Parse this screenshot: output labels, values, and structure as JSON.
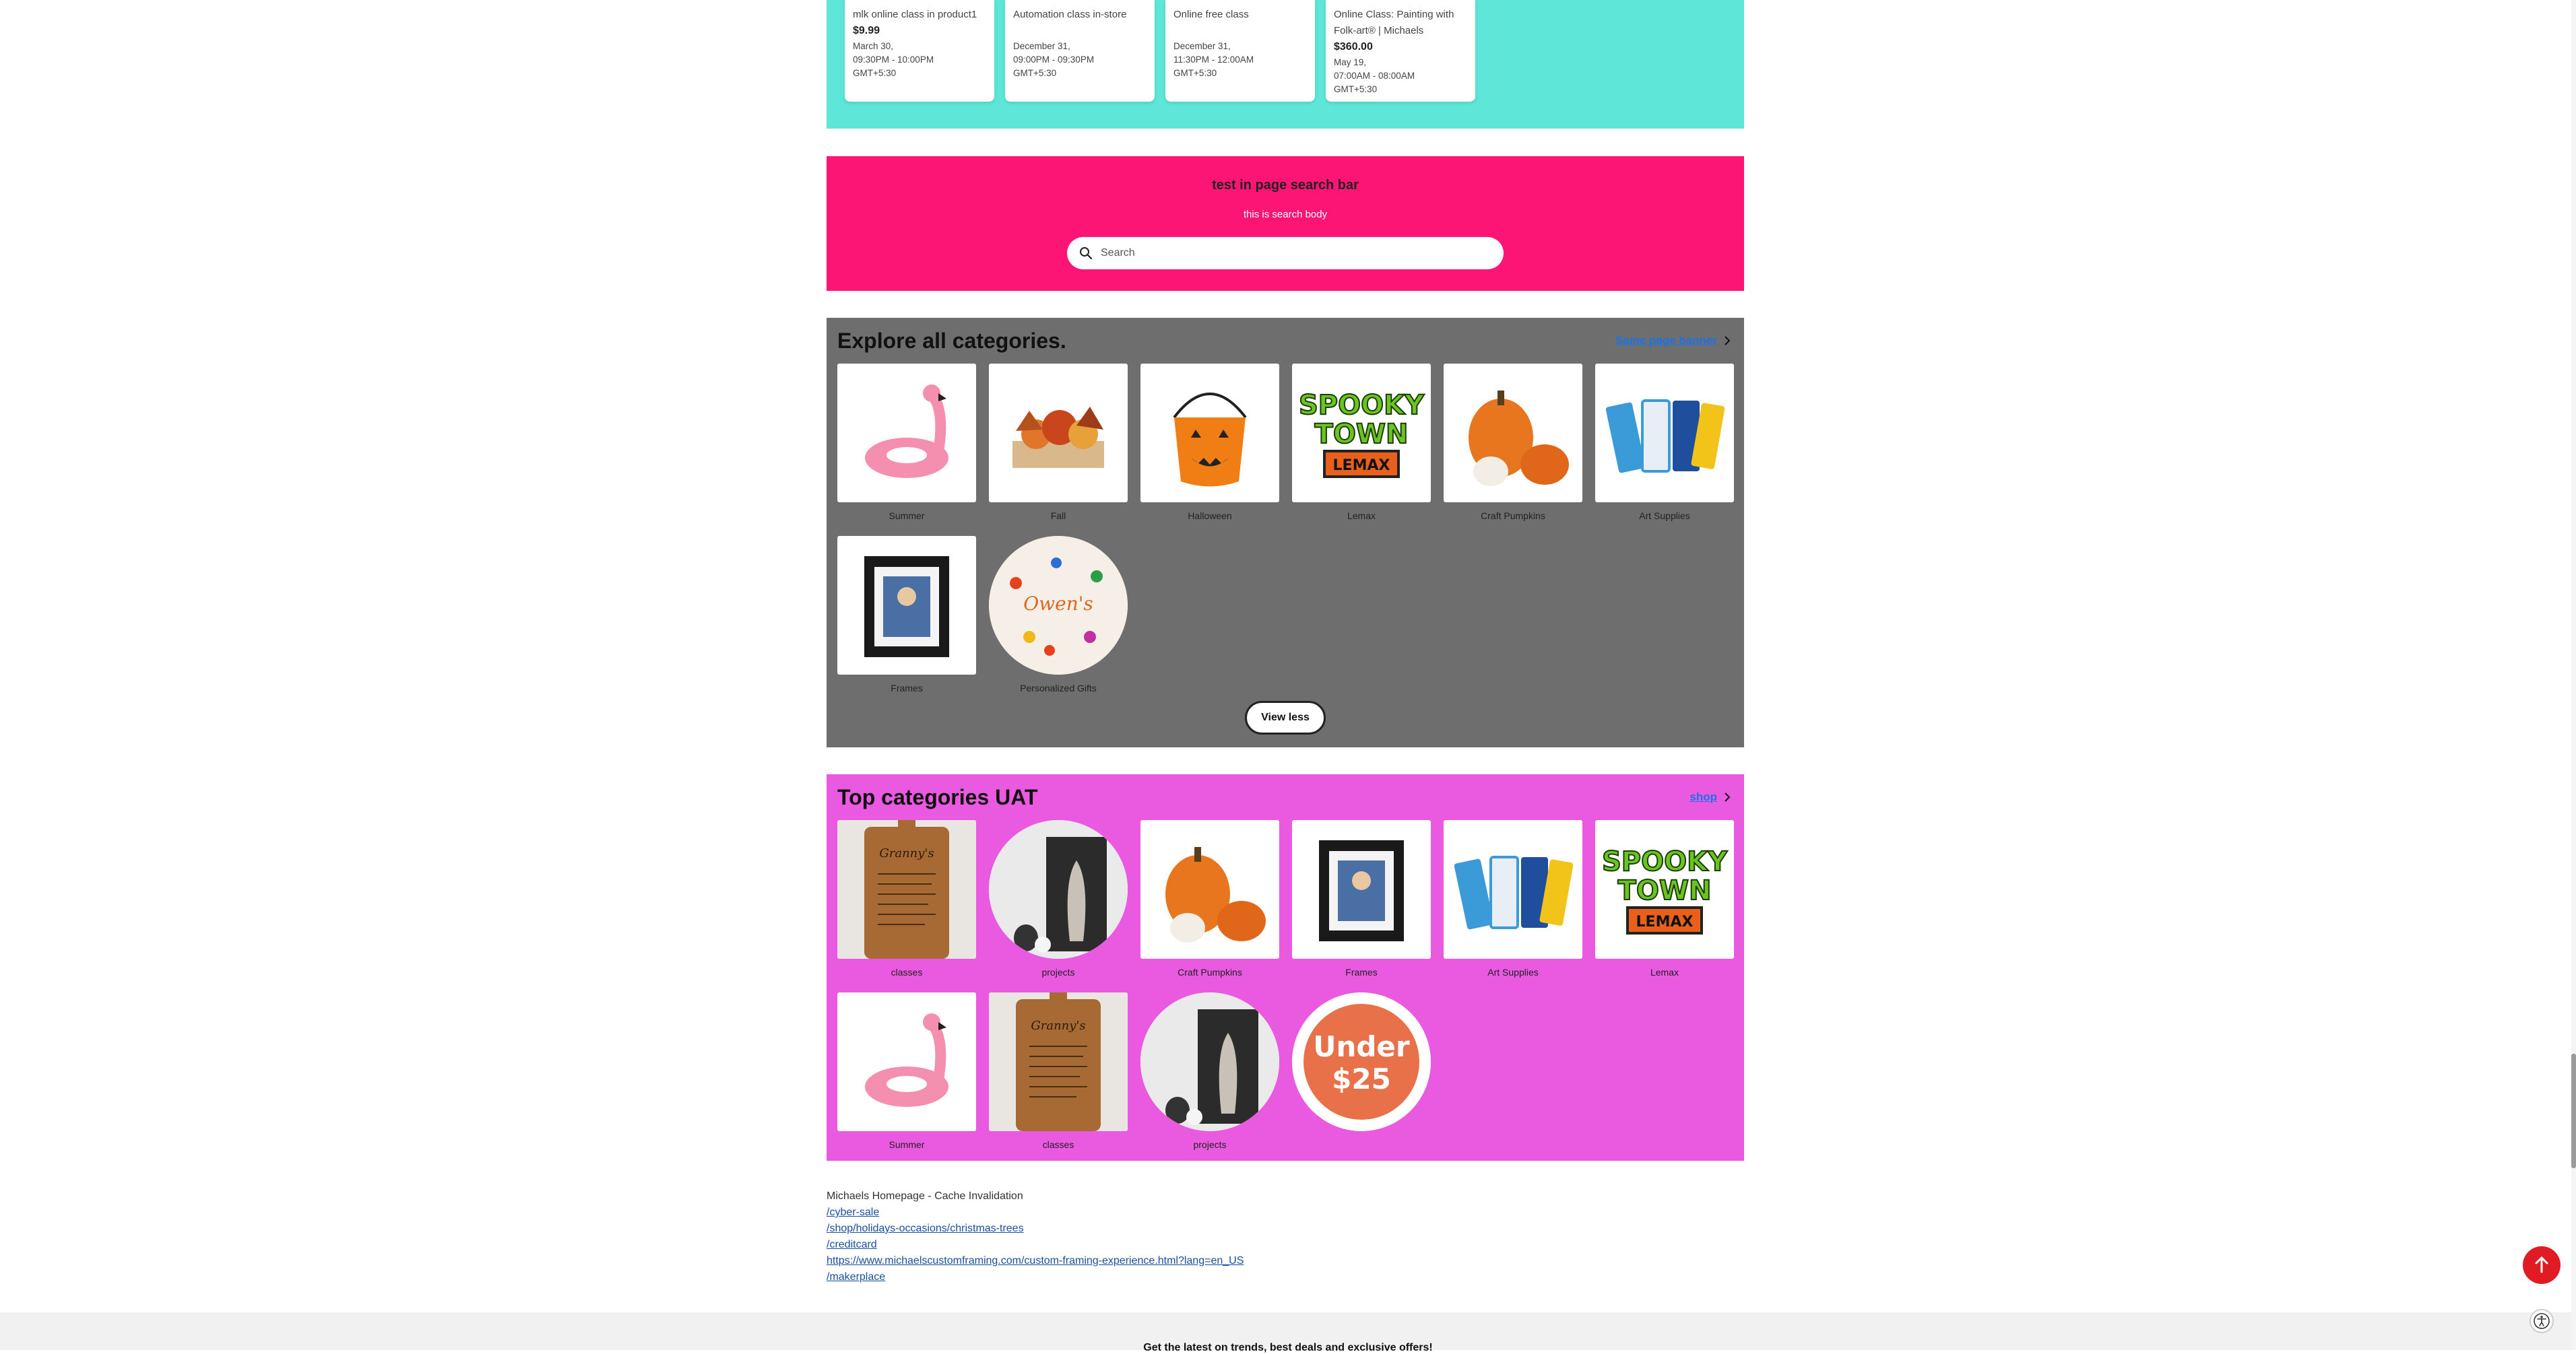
{
  "classes": [
    {
      "title": "mlk online class in product1",
      "price": "$9.99",
      "date": "March 30,",
      "time": "09:30PM - 10:00PM",
      "tz": "GMT+5:30"
    },
    {
      "title": "Automation class in-store",
      "price": "",
      "date": "December 31,",
      "time": "09:00PM - 09:30PM",
      "tz": "GMT+5:30"
    },
    {
      "title": "Online free class",
      "price": "",
      "date": "December 31,",
      "time": "11:30PM - 12:00AM",
      "tz": "GMT+5:30"
    },
    {
      "title": "Online Class: Painting with Folk-art® | Michaels",
      "price": "$360.00",
      "date": "May 19,",
      "time": "07:00AM - 08:00AM",
      "tz": "GMT+5:30"
    }
  ],
  "search_section": {
    "title": "test in page search bar",
    "body": "this is search body",
    "placeholder": "Search"
  },
  "explore": {
    "title": "Explore all categories.",
    "link": "Same page banner",
    "items": [
      {
        "label": "Summer",
        "icon": "flamingo-float-image"
      },
      {
        "label": "Fall",
        "icon": "fall-centerpiece-image"
      },
      {
        "label": "Halloween",
        "icon": "pumpkin-bucket-image"
      },
      {
        "label": "Lemax",
        "icon": "spooky-town-logo-image"
      },
      {
        "label": "Craft Pumpkins",
        "icon": "craft-pumpkins-image"
      },
      {
        "label": "Art Supplies",
        "icon": "paint-tubes-image"
      },
      {
        "label": "Frames",
        "icon": "photo-frame-image"
      },
      {
        "label": "Personalized Gifts",
        "icon": "personalized-plate-image"
      }
    ],
    "view_less": "View less"
  },
  "top": {
    "title": "Top categories UAT",
    "link": "shop",
    "items": [
      {
        "label": "classes",
        "icon": "cutting-board-image"
      },
      {
        "label": "projects",
        "icon": "tree-art-image"
      },
      {
        "label": "Craft Pumpkins",
        "icon": "craft-pumpkins-image"
      },
      {
        "label": "Frames",
        "icon": "photo-frame-image"
      },
      {
        "label": "Art Supplies",
        "icon": "paint-tubes-image"
      },
      {
        "label": "Lemax",
        "icon": "spooky-town-logo-image"
      },
      {
        "label": "Summer",
        "icon": "flamingo-float-image"
      },
      {
        "label": "classes",
        "icon": "cutting-board-image"
      },
      {
        "label": "projects",
        "icon": "tree-art-image"
      },
      {
        "label": "",
        "icon": "under-25-badge-image",
        "badge_line1": "Under",
        "badge_line2": "$25"
      }
    ]
  },
  "links": {
    "title": "Michaels Homepage - Cache Invalidation",
    "items": [
      "/cyber-sale",
      "/shop/holidays-occasions/christmas-trees",
      "/creditcard",
      "https://www.michaelscustomframing.com/custom-framing-experience.html?lang=en_US",
      "/makerplace"
    ]
  },
  "footer": {
    "text": "Get the latest on trends, best deals and exclusive offers!"
  },
  "colors": {
    "classes_bg": "#5ee6d8",
    "search_bg": "#fc1574",
    "explore_bg": "#6e6e6e",
    "top_bg": "#e95ae0",
    "scroll_top_button": "#e01b24",
    "link": "#1a73e8"
  }
}
